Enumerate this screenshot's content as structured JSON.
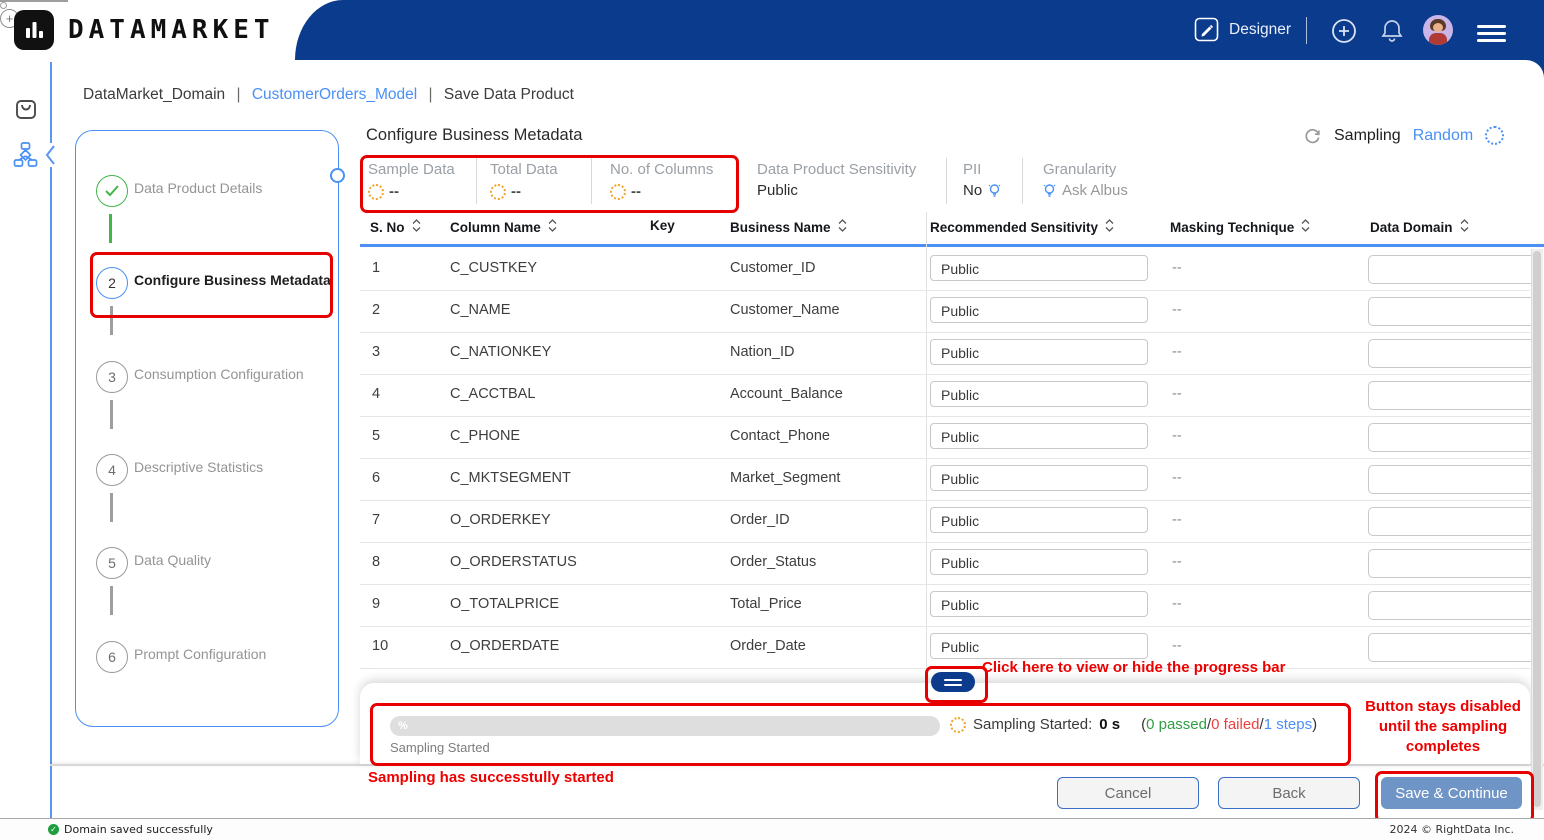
{
  "colors": {
    "header_blue": "#0b3b8c",
    "link_blue": "#4a90f5",
    "success_green": "#43b649",
    "annotation_red": "#e60000",
    "disabled_button_blue": "#6f94c6",
    "passed_green": "#2f9e44",
    "failed_red": "#f03e3e",
    "steps_blue": "#4a90f5"
  },
  "brand": {
    "logo_text": "DATAMARKET"
  },
  "header": {
    "designer": "Designer"
  },
  "breadcrumb": {
    "items": [
      "DataMarket_Domain",
      "CustomerOrders_Model",
      "Save Data Product"
    ],
    "separator": "|"
  },
  "nav_rail": {
    "items": [
      {
        "icon": "shopping-bag-icon",
        "active": false
      },
      {
        "icon": "data-flow-icon",
        "active": true
      }
    ]
  },
  "stepper": {
    "steps": [
      {
        "num": "1",
        "label": "Data Product Details",
        "state": "done"
      },
      {
        "num": "2",
        "label": "Configure Business Metadata",
        "state": "active",
        "annotated": true
      },
      {
        "num": "3",
        "label": "Consumption Configuration",
        "state": "pending"
      },
      {
        "num": "4",
        "label": "Descriptive Statistics",
        "state": "pending"
      },
      {
        "num": "5",
        "label": "Data Quality",
        "state": "pending",
        "has_add": true
      },
      {
        "num": "6",
        "label": "Prompt Configuration",
        "state": "pending"
      }
    ]
  },
  "main": {
    "title": "Configure Business Metadata",
    "sampling_label": "Sampling",
    "sampling_mode": "Random",
    "stats": [
      {
        "label": "Sample Data",
        "value": "--"
      },
      {
        "label": "Total Data",
        "value": "--"
      },
      {
        "label": "No. of Columns",
        "value": "--"
      }
    ],
    "info": [
      {
        "label": "Data Product Sensitivity",
        "value": "Public"
      },
      {
        "label": "PII",
        "value": "No"
      },
      {
        "label": "Granularity",
        "value": "Ask Albus"
      }
    ]
  },
  "table": {
    "headers": [
      {
        "label": "S. No",
        "sortable": true
      },
      {
        "label": "Column Name",
        "sortable": true
      },
      {
        "label": "Key",
        "sortable": false
      },
      {
        "label": "Business Name",
        "sortable": true
      },
      {
        "label": "Recommended Sensitivity",
        "sortable": true
      },
      {
        "label": "Masking Technique",
        "sortable": true
      },
      {
        "label": "Data Domain",
        "sortable": true
      }
    ],
    "rows": [
      {
        "no": "1",
        "column_name": "C_CUSTKEY",
        "key": "",
        "business_name": "Customer_ID",
        "sensitivity": "Public",
        "masking": "--",
        "data_domain": ""
      },
      {
        "no": "2",
        "column_name": "C_NAME",
        "key": "",
        "business_name": "Customer_Name",
        "sensitivity": "Public",
        "masking": "--",
        "data_domain": ""
      },
      {
        "no": "3",
        "column_name": "C_NATIONKEY",
        "key": "",
        "business_name": "Nation_ID",
        "sensitivity": "Public",
        "masking": "--",
        "data_domain": ""
      },
      {
        "no": "4",
        "column_name": "C_ACCTBAL",
        "key": "",
        "business_name": "Account_Balance",
        "sensitivity": "Public",
        "masking": "--",
        "data_domain": ""
      },
      {
        "no": "5",
        "column_name": "C_PHONE",
        "key": "",
        "business_name": "Contact_Phone",
        "sensitivity": "Public",
        "masking": "--",
        "data_domain": ""
      },
      {
        "no": "6",
        "column_name": "C_MKTSEGMENT",
        "key": "",
        "business_name": "Market_Segment",
        "sensitivity": "Public",
        "masking": "--",
        "data_domain": ""
      },
      {
        "no": "7",
        "column_name": "O_ORDERKEY",
        "key": "",
        "business_name": "Order_ID",
        "sensitivity": "Public",
        "masking": "--",
        "data_domain": ""
      },
      {
        "no": "8",
        "column_name": "O_ORDERSTATUS",
        "key": "",
        "business_name": "Order_Status",
        "sensitivity": "Public",
        "masking": "--",
        "data_domain": ""
      },
      {
        "no": "9",
        "column_name": "O_TOTALPRICE",
        "key": "",
        "business_name": "Total_Price",
        "sensitivity": "Public",
        "masking": "--",
        "data_domain": ""
      },
      {
        "no": "10",
        "column_name": "O_ORDERDATE",
        "key": "",
        "business_name": "Order_Date",
        "sensitivity": "Public",
        "masking": "--",
        "data_domain": ""
      }
    ]
  },
  "progress": {
    "bar_text": "%",
    "bar_caption": "Sampling Started",
    "status_label": "Sampling Started:",
    "elapsed": "0 s",
    "open_paren": "(",
    "passed": "0 passed",
    "slash1": "/",
    "failed": "0 failed",
    "slash2": "/",
    "steps": "1 steps",
    "close_paren": ")"
  },
  "annotations": {
    "toggle_hint": "Click here to view or hide the progress bar",
    "save_hint": "Button stays disabled until the sampling completes",
    "sampling_note": "Sampling has successtully started"
  },
  "footer": {
    "cancel": "Cancel",
    "back": "Back",
    "save": "Save & Continue"
  },
  "statusbar": {
    "message": "Domain saved successfully",
    "copyright": "2024 © RightData Inc."
  }
}
